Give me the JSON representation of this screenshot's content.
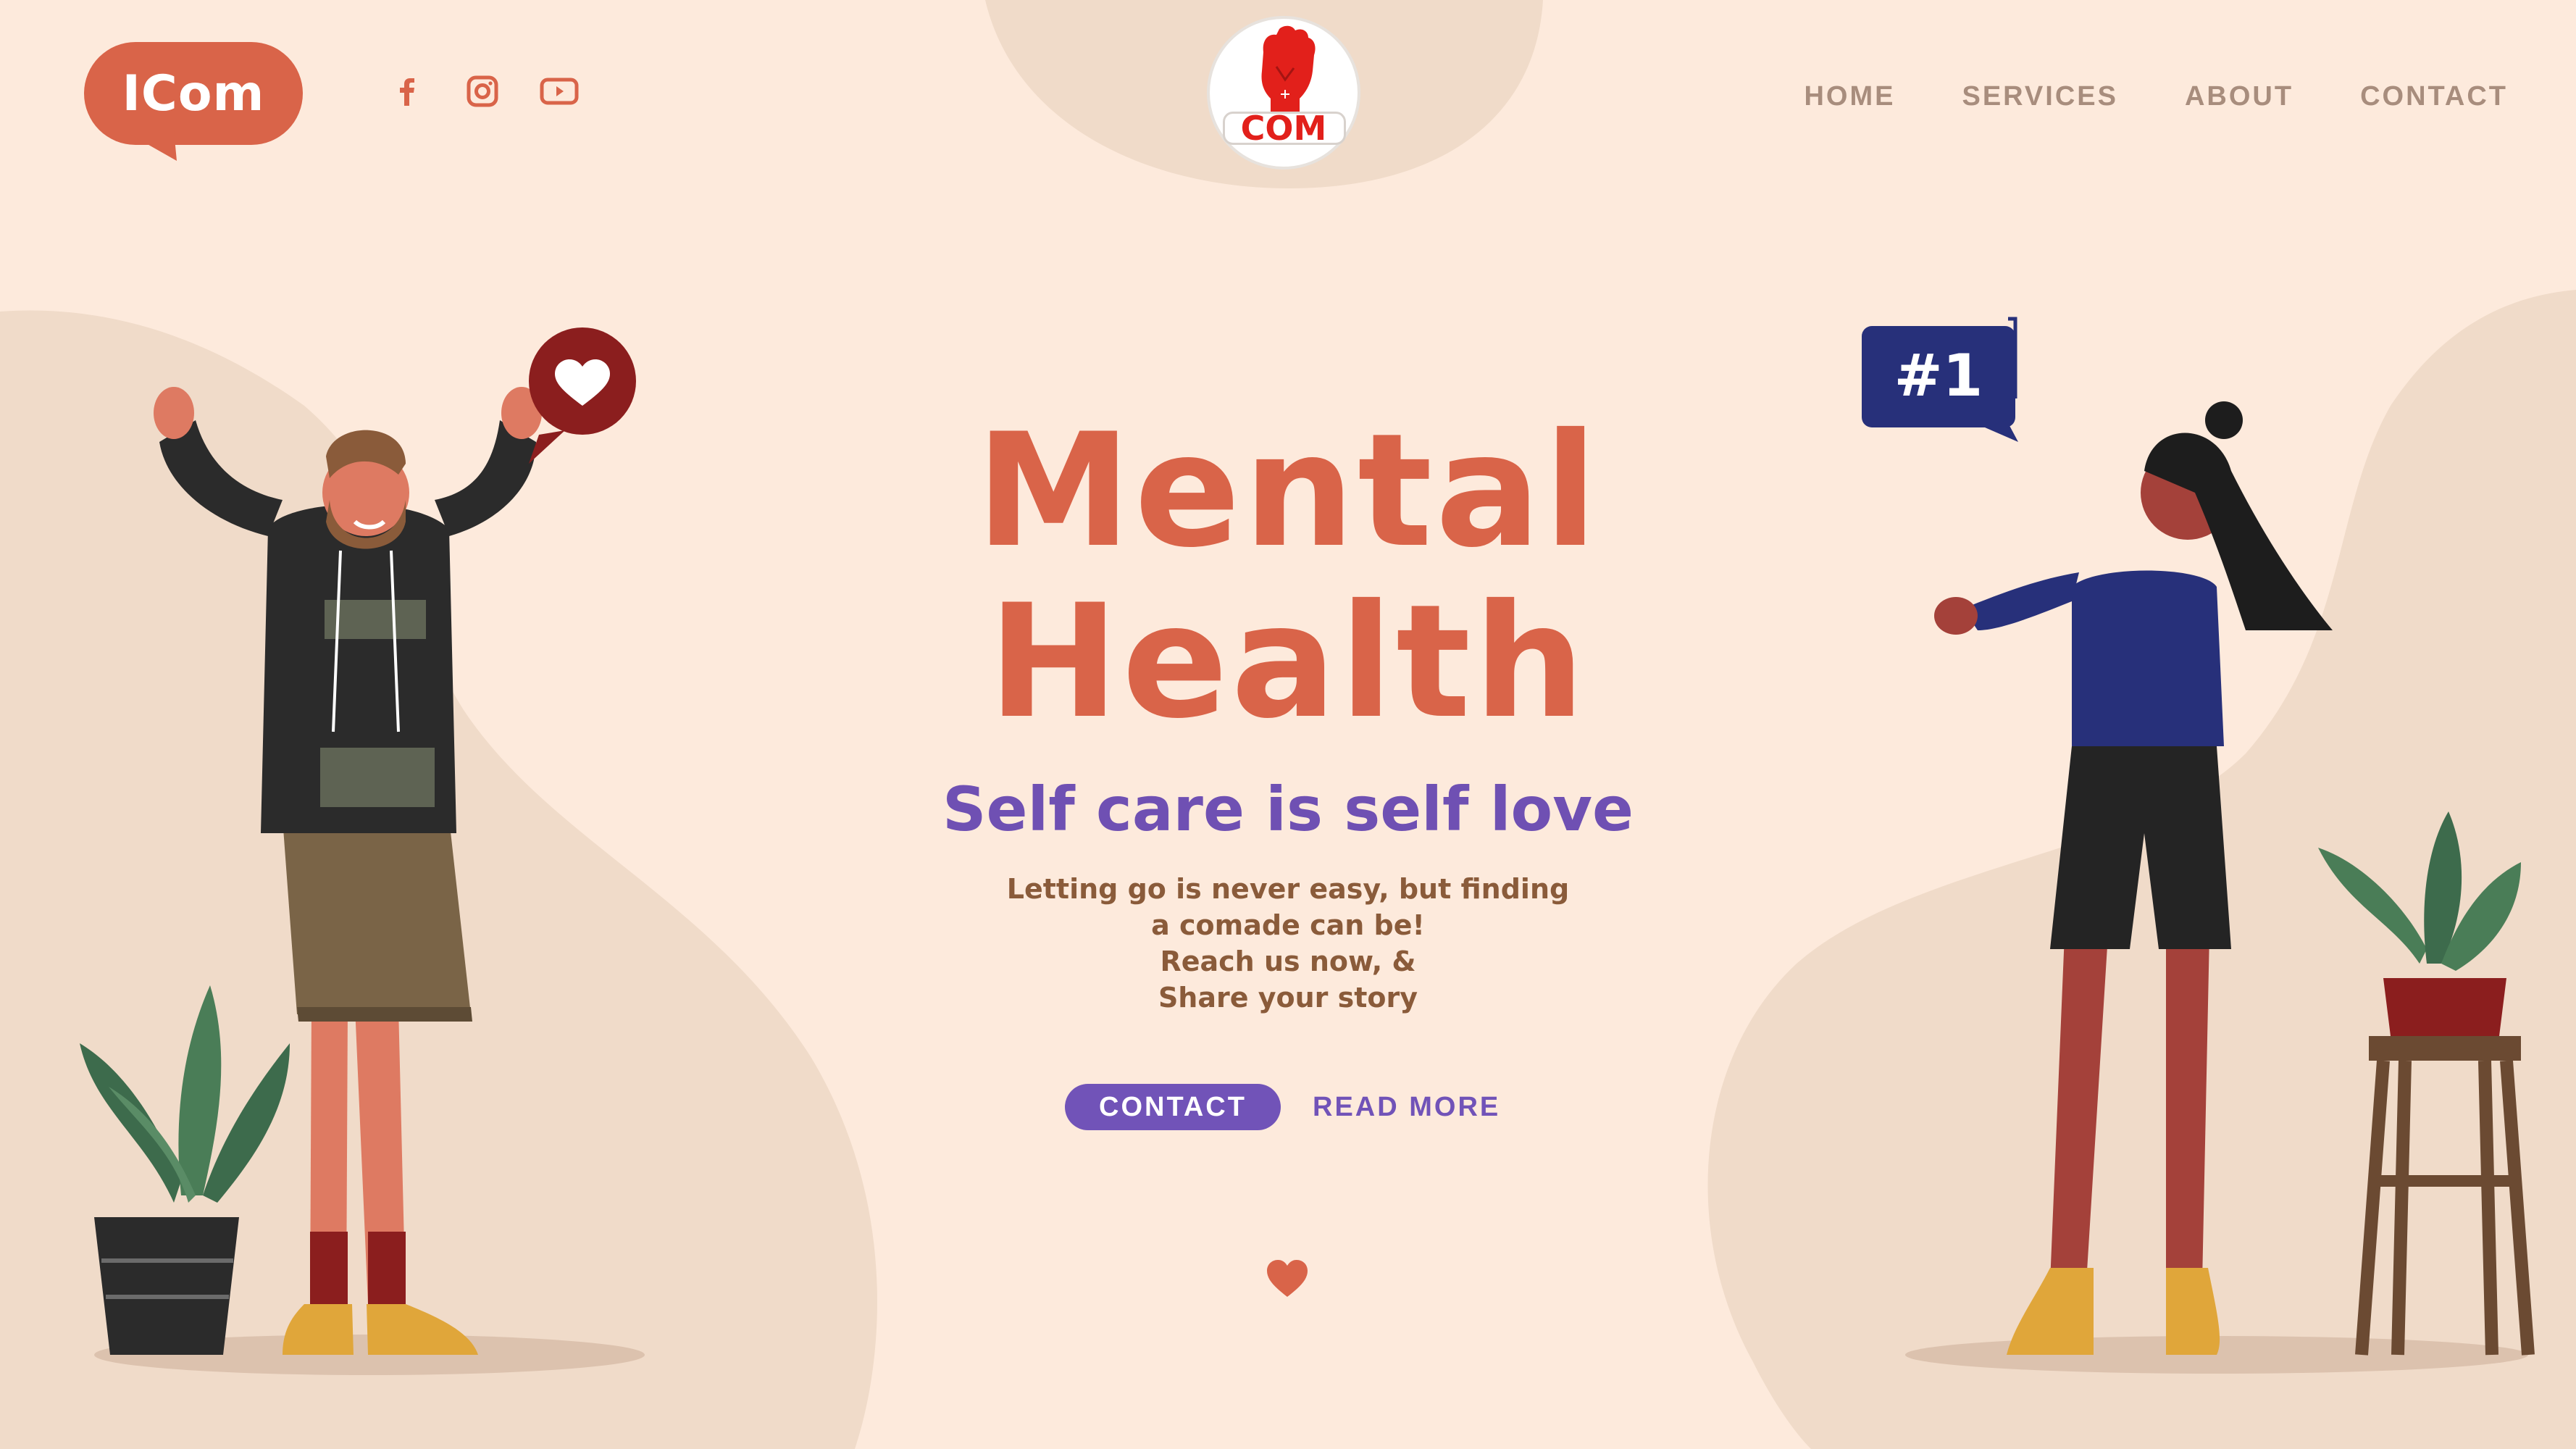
{
  "brand": {
    "name": "ICom"
  },
  "logo": {
    "text": "COM"
  },
  "social": [
    {
      "name": "facebook-icon"
    },
    {
      "name": "instagram-icon"
    },
    {
      "name": "youtube-icon"
    }
  ],
  "nav": {
    "items": [
      "HOME",
      "SERVICES",
      "ABOUT",
      "CONTACT"
    ]
  },
  "hero": {
    "title_line1": "Mental",
    "title_line2": "Health",
    "subtitle": "Self care is self love",
    "body": [
      "Letting go is never easy, but finding",
      "a comade can be!",
      "Reach us now, &",
      "Share your story"
    ],
    "cta_primary": "CONTACT",
    "cta_secondary": "READ MORE"
  },
  "badges": {
    "rank": "#1"
  },
  "colors": {
    "background": "#fdeadc",
    "blob": "#f0dbc9",
    "accent_orange": "#d96449",
    "accent_purple": "#6f50b3",
    "nav_text": "#a88d7d",
    "body_text": "#8a5b3a",
    "badge_navy": "#27307a"
  }
}
